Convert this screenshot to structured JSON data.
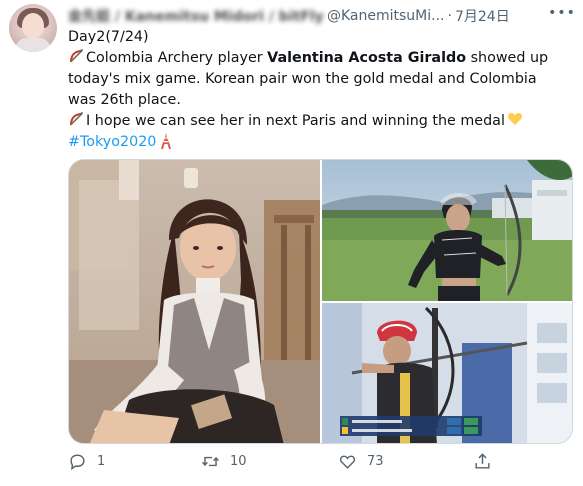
{
  "header": {
    "display_name": "金先姐 / Kanemitsu Midori / bitFlyer",
    "handle": "@KanemitsuMi...",
    "dot": "·",
    "date": "7月24日",
    "more_icon": "more-dots-icon"
  },
  "tweet": {
    "line1": "Day2(7/24)",
    "line2_pre": "Colombia Archery player ",
    "line2_bold": "Valentina Acosta Giraldo",
    "line2_post": " showed up today's mix game. Korean pair won the gold medal and Colombia was 26th place.",
    "line3": "I hope we can see her in next Paris and winning the medal",
    "hashtag": "#Tokyo2020",
    "emoji_icons": [
      "bow-and-arrow-icon",
      "yellow-heart-icon",
      "tokyo-tower-icon"
    ]
  },
  "media": {
    "images": [
      "photo-portrait-sitting",
      "photo-archer-field",
      "photo-archer-competition"
    ]
  },
  "actions": {
    "reply_count": "1",
    "retweet_count": "10",
    "like_count": "73",
    "share_icon": "share-icon"
  },
  "colors": {
    "accent": "#1d9bf0",
    "secondary_text": "#536471",
    "border": "#cfd9de"
  }
}
